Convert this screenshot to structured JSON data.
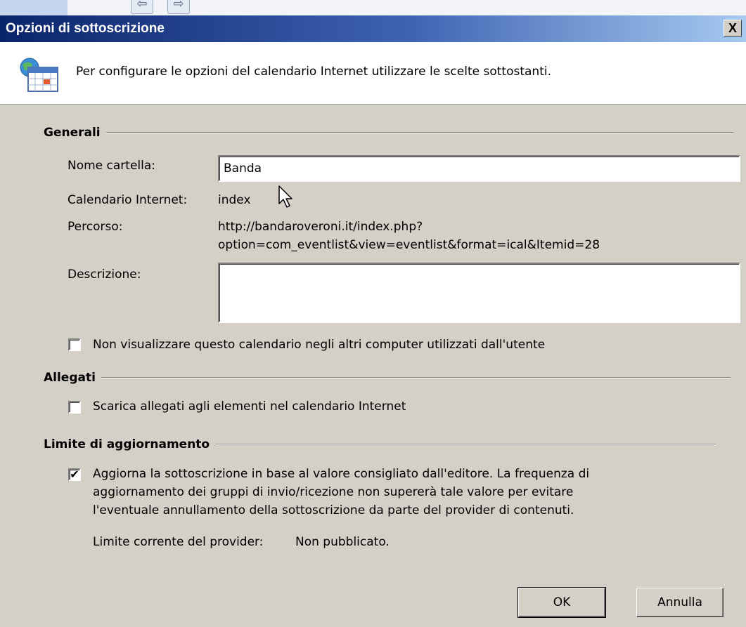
{
  "window": {
    "title": "Opzioni di sottoscrizione",
    "close_glyph": "X"
  },
  "header": {
    "icon": "internet-calendar-icon",
    "text": "Per configurare le opzioni del calendario Internet utilizzare le scelte sottostanti."
  },
  "sections": {
    "general": "Generali",
    "attachments": "Allegati",
    "update_limit": "Limite di aggiornamento"
  },
  "general": {
    "folder_name_label": "Nome cartella:",
    "folder_name_value": "Banda",
    "internet_calendar_label": "Calendario Internet:",
    "internet_calendar_value": "index",
    "path_label": "Percorso:",
    "path_line1": "http://bandaroveroni.it/index.php?",
    "path_line2": "option=com_eventlist&view=eventlist&format=ical&Itemid=28",
    "description_label": "Descrizione:",
    "description_value": "",
    "hide_checkbox_label": "Non visualizzare questo calendario negli altri computer utilizzati dall'utente",
    "hide_checked": false
  },
  "attachments": {
    "download_label": "Scarica allegati agli elementi nel calendario Internet",
    "download_checked": false
  },
  "update": {
    "line1": "Aggiorna la sottoscrizione in base al valore consigliato dall'editore. La frequenza di",
    "line2": "aggiornamento dei gruppi di invio/ricezione non supererà tale valore per evitare",
    "line3": "l'eventuale annullamento della sottoscrizione da parte del provider di contenuti.",
    "checked": true,
    "check_glyph": "✔",
    "provider_limit_label": "Limite corrente del provider:",
    "provider_limit_value": "Non pubblicato."
  },
  "buttons": {
    "ok": "OK",
    "cancel": "Annulla"
  }
}
